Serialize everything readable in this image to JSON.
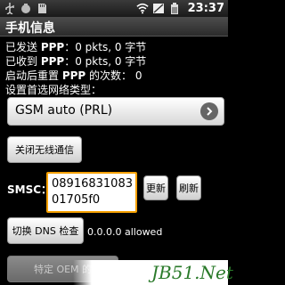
{
  "status_bar": {
    "time": "23:37",
    "icons_left": [
      "usb-icon",
      "debug-icon",
      "sd-card-icon"
    ],
    "icons_right": [
      "wifi-icon",
      "signal-off-icon",
      "battery-icon"
    ]
  },
  "title": "手机信息",
  "stats": {
    "sent_label": "已发送 ",
    "sent_proto": "PPP",
    "sent_value": "：0 pkts, 0 字节",
    "recv_label": "已收到 ",
    "recv_proto": "PPP",
    "recv_value": "：0 pkts, 0 字节",
    "reset_label": "启动后重置 ",
    "reset_proto": "PPP",
    "reset_value": " 的次数： 0"
  },
  "network_type_label": "设置首选网络类型：",
  "network_type_value": "GSM auto (PRL)",
  "radio_off_button": "关闭无线通信",
  "smsc": {
    "label": "SMSC：",
    "value": "0891683108301705f0",
    "update_button": "更新",
    "refresh_button": "刷新"
  },
  "dns": {
    "button": "切换 DNS 检查",
    "status": "0.0.0.0 allowed"
  },
  "oem_button": "特定 OEM 的",
  "watermark": "JB51.Net"
}
